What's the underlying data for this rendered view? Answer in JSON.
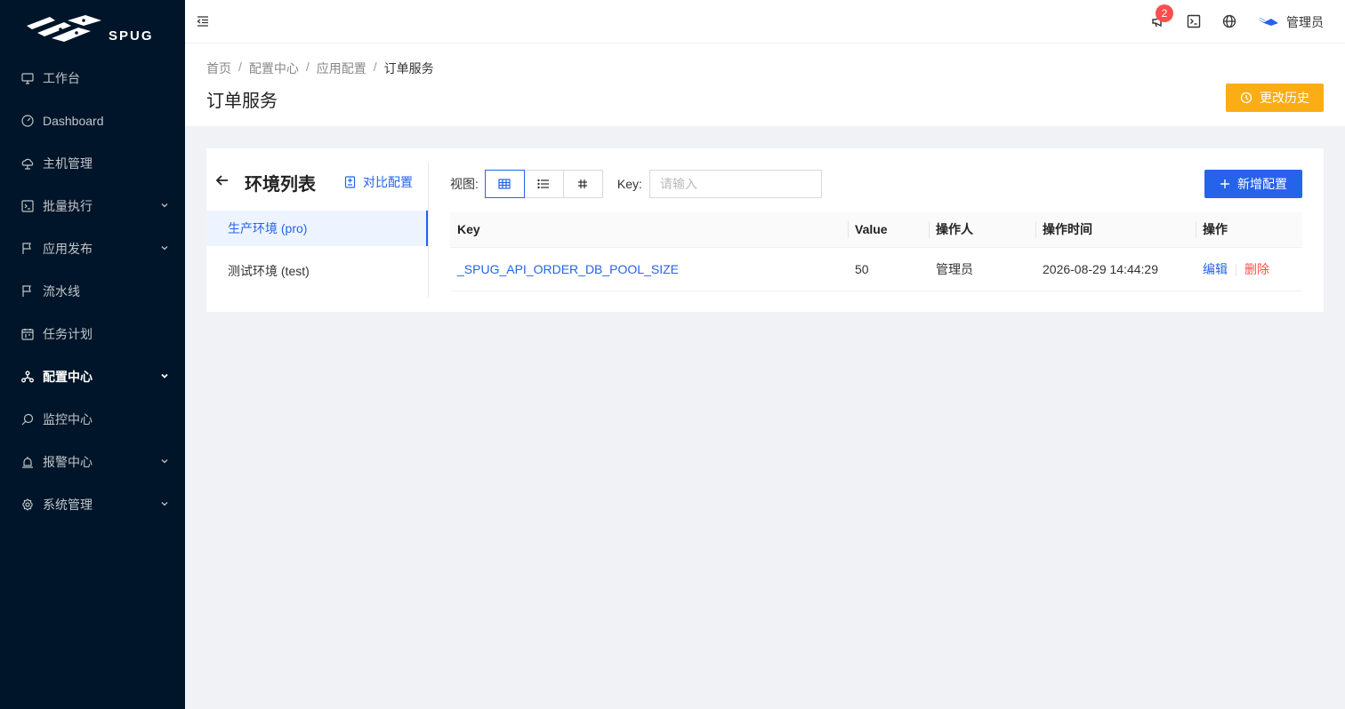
{
  "brand": {
    "name": "SPUG"
  },
  "sidebar": {
    "items": [
      {
        "label": "工作台",
        "icon": "desktop-icon"
      },
      {
        "label": "Dashboard",
        "icon": "dashboard-icon"
      },
      {
        "label": "主机管理",
        "icon": "cloud-server-icon"
      },
      {
        "label": "批量执行",
        "icon": "code-icon",
        "has_children": true
      },
      {
        "label": "应用发布",
        "icon": "flag-icon",
        "has_children": true
      },
      {
        "label": "流水线",
        "icon": "flag-icon"
      },
      {
        "label": "任务计划",
        "icon": "schedule-icon"
      },
      {
        "label": "配置中心",
        "icon": "deployment-icon",
        "has_children": true,
        "active": true
      },
      {
        "label": "监控中心",
        "icon": "monitor-icon"
      },
      {
        "label": "报警中心",
        "icon": "alert-icon",
        "has_children": true
      },
      {
        "label": "系统管理",
        "icon": "setting-icon",
        "has_children": true
      }
    ]
  },
  "header": {
    "notification_count": "2",
    "user_name": "管理员"
  },
  "breadcrumb": [
    "首页",
    "配置中心",
    "应用配置",
    "订单服务"
  ],
  "page": {
    "title": "订单服务",
    "history_label": "更改历史"
  },
  "env": {
    "title": "环境列表",
    "compare_label": "对比配置",
    "items": [
      "生产环境 (pro)",
      "测试环境 (test)"
    ]
  },
  "toolbar": {
    "view_label": "视图:",
    "key_label": "Key:",
    "search_placeholder": "请输入",
    "add_label": "新增配置"
  },
  "table": {
    "columns": [
      "Key",
      "Value",
      "操作人",
      "操作时间",
      "操作"
    ],
    "rows": [
      {
        "key": "_SPUG_API_ORDER_DB_POOL_SIZE",
        "value": "50",
        "operator": "管理员",
        "time": "2026-08-29 14:44:29",
        "edit": "编辑",
        "delete": "删除"
      }
    ]
  },
  "colors": {
    "sidebar_bg": "#001529",
    "primary": "#2563eb",
    "warning": "#faad14",
    "danger": "#ff4d4f"
  }
}
